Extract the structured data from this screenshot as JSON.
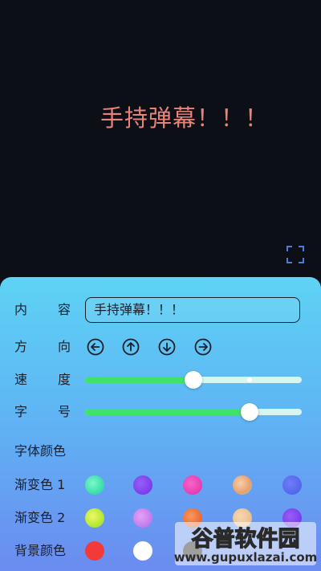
{
  "preview": {
    "text": "手持弹幕！！！",
    "fullscreen_icon": "fullscreen-icon"
  },
  "settings": {
    "content": {
      "label_a": "内",
      "label_b": "容",
      "value": "手持弹幕！！！"
    },
    "direction": {
      "label_a": "方",
      "label_b": "向",
      "icons": [
        "arrow-left-circle-icon",
        "arrow-up-circle-icon",
        "arrow-down-circle-icon",
        "arrow-right-circle-icon"
      ]
    },
    "speed": {
      "label_a": "速",
      "label_b": "度",
      "level": 0.5
    },
    "font_size": {
      "label_a": "字",
      "label_b": "号",
      "level": 0.76
    },
    "font_color": {
      "label": "字体颜色"
    },
    "gradient1": {
      "label": "渐变色 1",
      "colors": [
        "#4df2b2",
        "#7b3ef2",
        "#f23cb4",
        "#f2b88a",
        "#5a78f2"
      ]
    },
    "gradient2": {
      "label": "渐变色 2",
      "colors": [
        "#d6f23c",
        "#c47af2",
        "#f2621e",
        "#f2c08a",
        "#7a3ef2"
      ]
    },
    "background": {
      "label": "背景颜色",
      "colors": [
        "#f23a3a",
        "#ffffff",
        "#2a2a2a"
      ]
    }
  },
  "watermark": {
    "line1": "谷普软件园",
    "line2": "www.gupuxlazai.com"
  }
}
